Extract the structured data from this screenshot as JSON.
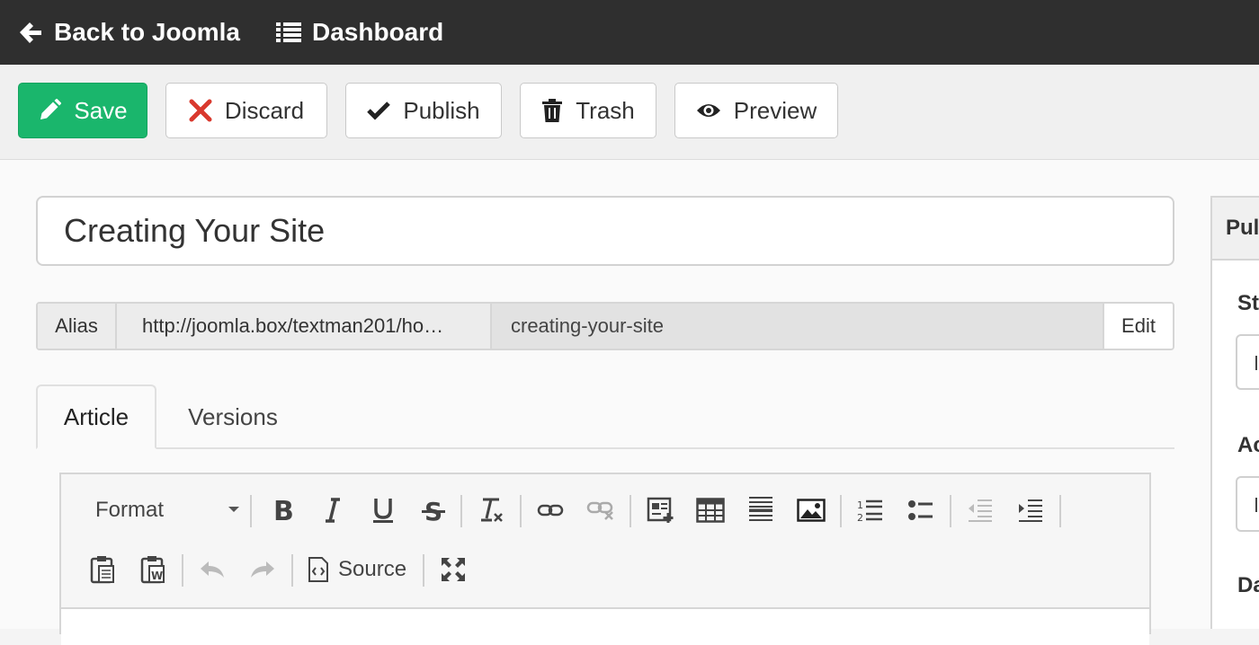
{
  "topbar": {
    "back_label": "Back to Joomla",
    "dashboard_label": "Dashboard"
  },
  "toolbar": {
    "save_label": "Save",
    "discard_label": "Discard",
    "publish_label": "Publish",
    "trash_label": "Trash",
    "preview_label": "Preview",
    "colors": {
      "save": "#1ab66c",
      "discard_icon": "#d9392e"
    }
  },
  "article": {
    "title": "Creating Your Site",
    "alias": {
      "label": "Alias",
      "url": "http://joomla.box/textman201/ho…",
      "value": "creating-your-site",
      "edit_label": "Edit"
    },
    "tabs": [
      {
        "label": "Article",
        "active": true
      },
      {
        "label": "Versions",
        "active": false
      }
    ]
  },
  "editor": {
    "format_label": "Format",
    "source_label": "Source",
    "row1_icons": [
      "bold-icon",
      "italic-icon",
      "underline-icon",
      "strikethrough-icon",
      "clear-formatting-icon",
      "link-icon",
      "unlink-icon",
      "insert-readmore-icon",
      "table-icon",
      "horizontal-rule-icon",
      "image-icon",
      "numbered-list-icon",
      "bullet-list-icon",
      "outdent-icon",
      "indent-icon"
    ],
    "row2_icons": [
      "paste-icon",
      "paste-word-icon",
      "undo-icon",
      "redo-icon",
      "source-code-icon",
      "fullscreen-icon"
    ]
  },
  "sidepanel": {
    "heading": "Pul",
    "label1": "St",
    "label2": "Ac",
    "label3": "Da"
  }
}
